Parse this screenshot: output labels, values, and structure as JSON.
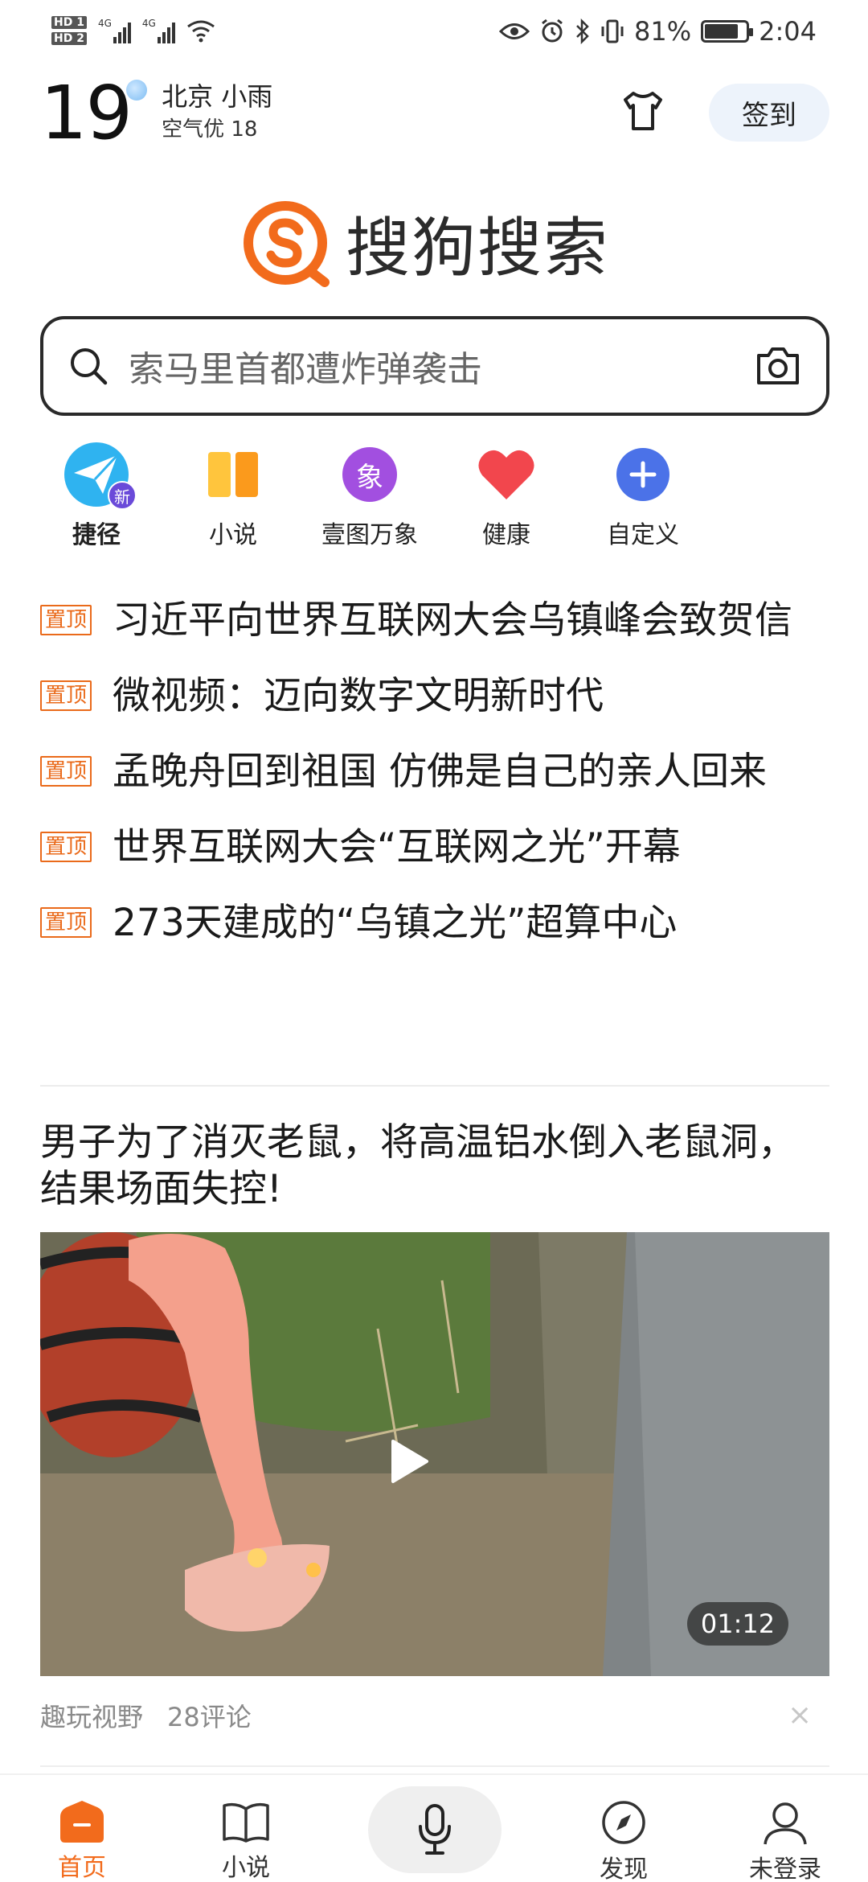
{
  "status_bar": {
    "hd1": "HD 1",
    "hd2": "HD 2",
    "sig1": "4G",
    "sig2": "4G",
    "battery_percent_text": "81%",
    "battery_level": 0.81,
    "time": "2:04"
  },
  "header": {
    "temperature": "19",
    "city_weather": "北京 小雨",
    "air_quality": "空气优 18",
    "checkin_label": "签到"
  },
  "logo": {
    "text": "搜狗搜索",
    "accent": "#f26b1c"
  },
  "search": {
    "query_hint": "索马里首都遭炸弹袭击"
  },
  "shortcuts": [
    {
      "label": "捷径",
      "icon": "paper-plane-icon",
      "badge": "新"
    },
    {
      "label": "小说",
      "icon": "book-icon"
    },
    {
      "label": "壹图万象",
      "icon": "elephant-icon",
      "glyph": "象"
    },
    {
      "label": "健康",
      "icon": "heart-icon"
    },
    {
      "label": "自定义",
      "icon": "plus-icon"
    }
  ],
  "pin_tag": "置顶",
  "pinned_news": [
    "习近平向世界互联网大会乌镇峰会致贺信",
    "微视频：迈向数字文明新时代",
    "孟晚舟回到祖国 仿佛是自己的亲人回来",
    "世界互联网大会“互联网之光”开幕",
    "273天建成的“乌镇之光”超算中心"
  ],
  "feed": {
    "title": "男子为了消灭老鼠，将高温铝水倒入老鼠洞，结果场面失控!",
    "duration": "01:12",
    "source": "趣玩视野",
    "comments": "28评论",
    "close": "×"
  },
  "bottom_nav": {
    "home": "首页",
    "novel": "小说",
    "discover": "发现",
    "account": "未登录"
  }
}
